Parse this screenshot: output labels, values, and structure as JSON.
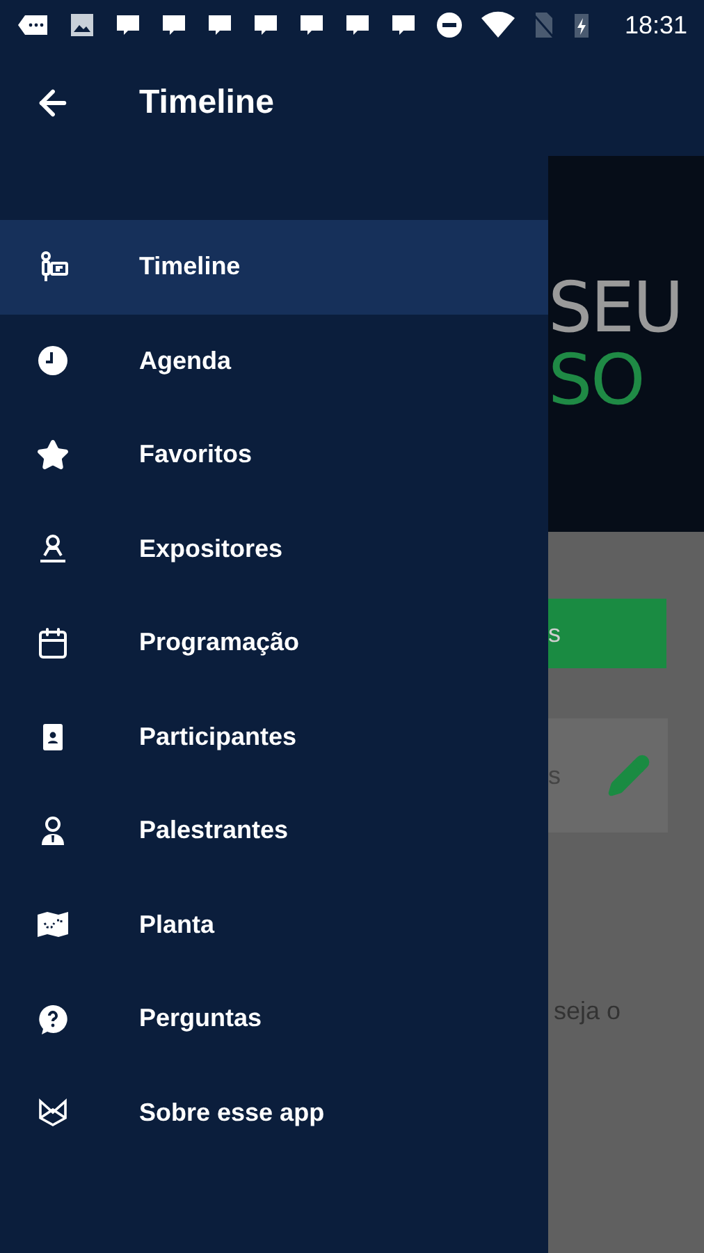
{
  "status_bar": {
    "time": "18:31"
  },
  "drawer": {
    "title": "Timeline",
    "items": [
      {
        "label": "Timeline",
        "kind": "timeline",
        "selected": true
      },
      {
        "label": "Agenda",
        "kind": "clock",
        "selected": false
      },
      {
        "label": "Favoritos",
        "kind": "star",
        "selected": false
      },
      {
        "label": "Expositores",
        "kind": "stamp",
        "selected": false
      },
      {
        "label": "Programação",
        "kind": "calendar",
        "selected": false
      },
      {
        "label": "Participantes",
        "kind": "badge",
        "selected": false
      },
      {
        "label": "Palestrantes",
        "kind": "speaker",
        "selected": false
      },
      {
        "label": "Planta",
        "kind": "map",
        "selected": false
      },
      {
        "label": "Perguntas",
        "kind": "question",
        "selected": false
      },
      {
        "label": "Sobre esse app",
        "kind": "about",
        "selected": false
      }
    ]
  },
  "background": {
    "banner_line_1": "SEU",
    "banner_line_2": "SO",
    "button": "s",
    "card_text": "s",
    "text": "seja o"
  }
}
